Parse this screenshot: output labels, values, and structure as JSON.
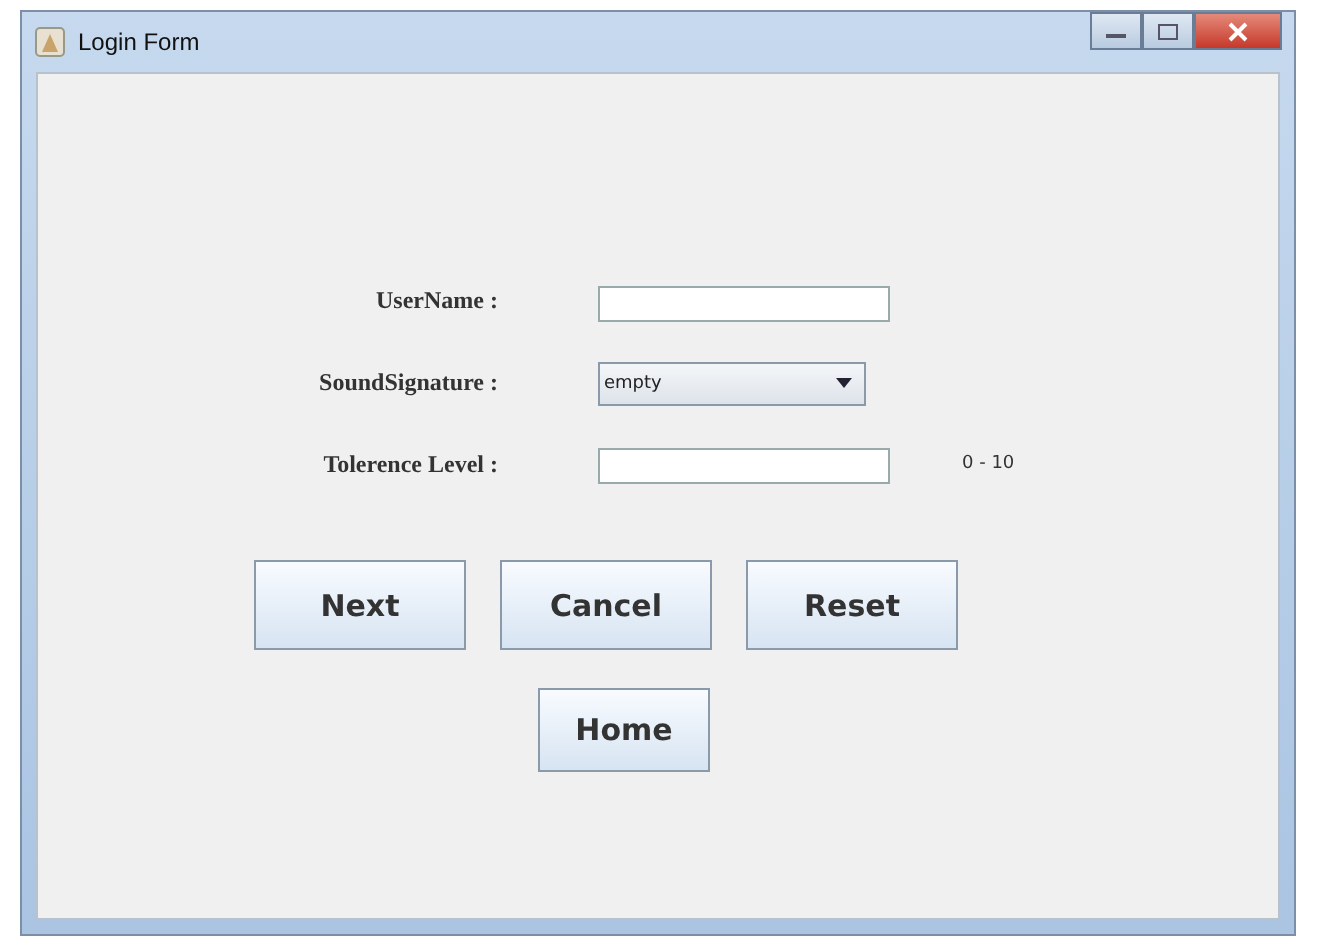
{
  "window": {
    "title": "Login Form"
  },
  "fields": [
    {
      "label": "UserName :",
      "kind": "text"
    },
    {
      "label": "SoundSignature :",
      "kind": "combo",
      "value": "empty"
    },
    {
      "label": "Tolerence Level :",
      "kind": "text",
      "hint": "0 - 10"
    }
  ],
  "button_rows": [
    [
      "Next",
      "Cancel",
      "Reset"
    ],
    [
      "Home"
    ]
  ]
}
